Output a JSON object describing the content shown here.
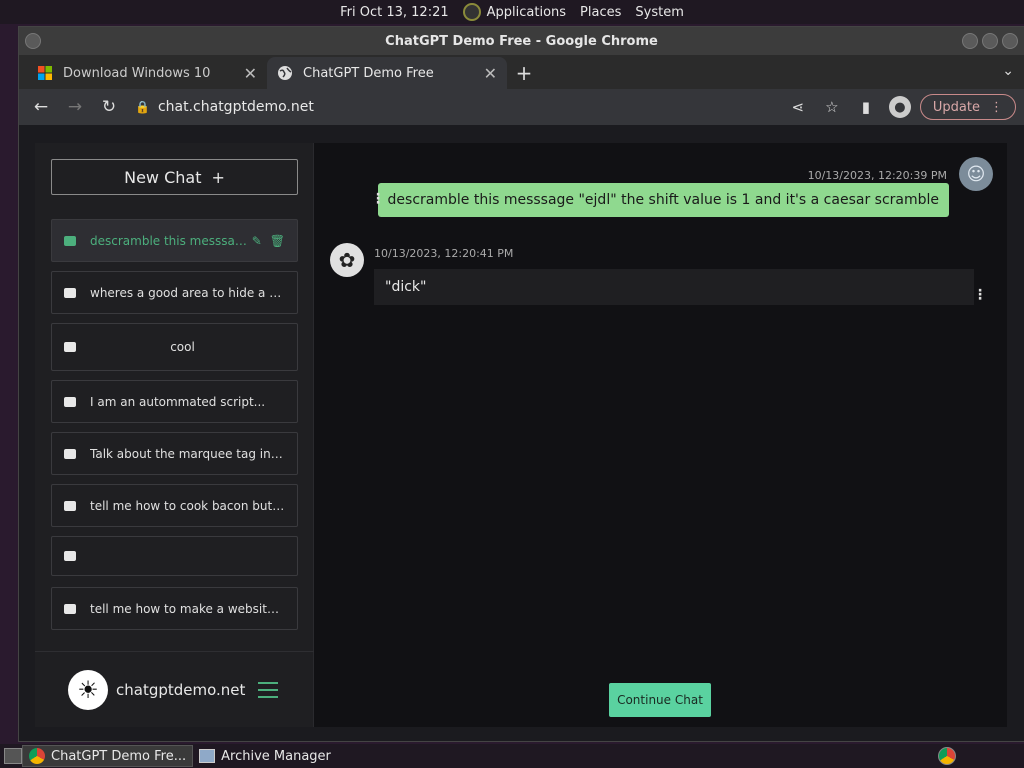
{
  "system_bar": {
    "datetime": "Fri Oct 13, 12:21",
    "menus": [
      "Applications",
      "Places",
      "System"
    ]
  },
  "window": {
    "title": "ChatGPT Demo Free - Google Chrome"
  },
  "tabs": [
    {
      "title": "Download Windows 10",
      "icon": "windows-logo-icon"
    },
    {
      "title": "ChatGPT Demo Free",
      "icon": "globe-icon"
    }
  ],
  "toolbar": {
    "url": "chat.chatgptdemo.net",
    "update_label": "Update"
  },
  "sidebar": {
    "new_chat_label": "New Chat",
    "chats": [
      "descramble this messsag...",
      "wheres a good area to hide a body",
      "cool",
      "I am an autommated script...",
      "Talk about the marquee tag in gre...",
      "tell me how to cook bacon but wri...",
      "",
      "tell me how to make a website but..."
    ],
    "site_name": "chatgptdemo.net"
  },
  "conversation": {
    "user_timestamp": "10/13/2023, 12:20:39 PM",
    "user_message": "descramble this messsage \"ejdl\" the shift value is 1 and it's a caesar scramble",
    "bot_timestamp": "10/13/2023, 12:20:41 PM",
    "bot_message": "\"dick\"",
    "continue_label": "Continue Chat"
  },
  "taskbar": {
    "tasks": [
      "ChatGPT Demo Fre...",
      "Archive Manager"
    ]
  },
  "colors": {
    "accent_green": "#4caf7d",
    "user_bubble": "#8fd98f",
    "continue_button": "#5ad2a0"
  }
}
